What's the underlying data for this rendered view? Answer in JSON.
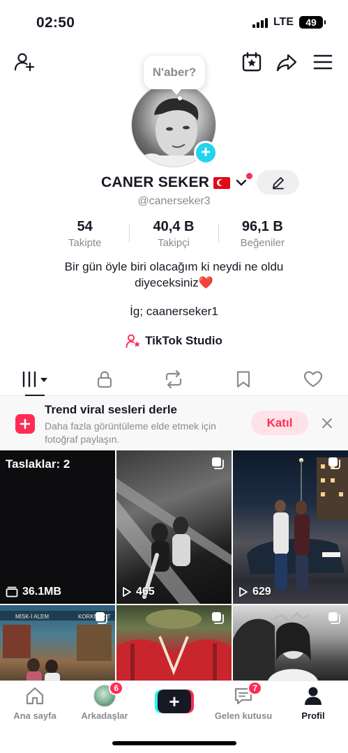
{
  "status_bar": {
    "time": "02:50",
    "network": "LTE",
    "battery": "49"
  },
  "header": {
    "add_friend_icon": "person-add-icon",
    "calendar_icon": "calendar-star-icon",
    "share_icon": "share-arrow-icon",
    "menu_icon": "hamburger-menu-icon"
  },
  "profile": {
    "bubble_text": "N'aber?",
    "name": "CANER SEKER",
    "username": "@canerseker3",
    "bio_line1": "Bir gün öyle biri olacağım ki neydi ne oldu",
    "bio_line2": "diyeceksiniz❤️",
    "instagram": "İg; caanerseker1",
    "studio_label": "TikTok Studio"
  },
  "stats": [
    {
      "value": "54",
      "label": "Takipte"
    },
    {
      "value": "40,4 B",
      "label": "Takipçi"
    },
    {
      "value": "96,1 B",
      "label": "Beğeniler"
    }
  ],
  "tabs": [
    {
      "icon": "grid-icon",
      "active": true
    },
    {
      "icon": "lock-icon",
      "active": false
    },
    {
      "icon": "repost-icon",
      "active": false
    },
    {
      "icon": "bookmark-icon",
      "active": false
    },
    {
      "icon": "heart-icon",
      "active": false
    }
  ],
  "banner": {
    "title": "Trend viral sesleri derle",
    "description": "Daha fazla görüntüleme elde etmek için fotoğraf paylaşın.",
    "join_label": "Katıl"
  },
  "grid": {
    "drafts_label": "Taslaklar: 2",
    "drafts_size": "36.1MB",
    "videos": [
      {
        "views": "465"
      },
      {
        "views": "629"
      }
    ],
    "tile4_sign_left": "MİSK-İ ALEM",
    "tile4_sign_right": "KORKMAZ T"
  },
  "nav": {
    "home": "Ana sayfa",
    "friends": "Arkadaşlar",
    "friends_badge": "6",
    "inbox": "Gelen kutusu",
    "inbox_badge": "7",
    "profile": "Profil"
  },
  "colors": {
    "accent": "#fe2c55",
    "cyan": "#25f4ee",
    "text": "#161823",
    "muted": "#8a8b91"
  }
}
